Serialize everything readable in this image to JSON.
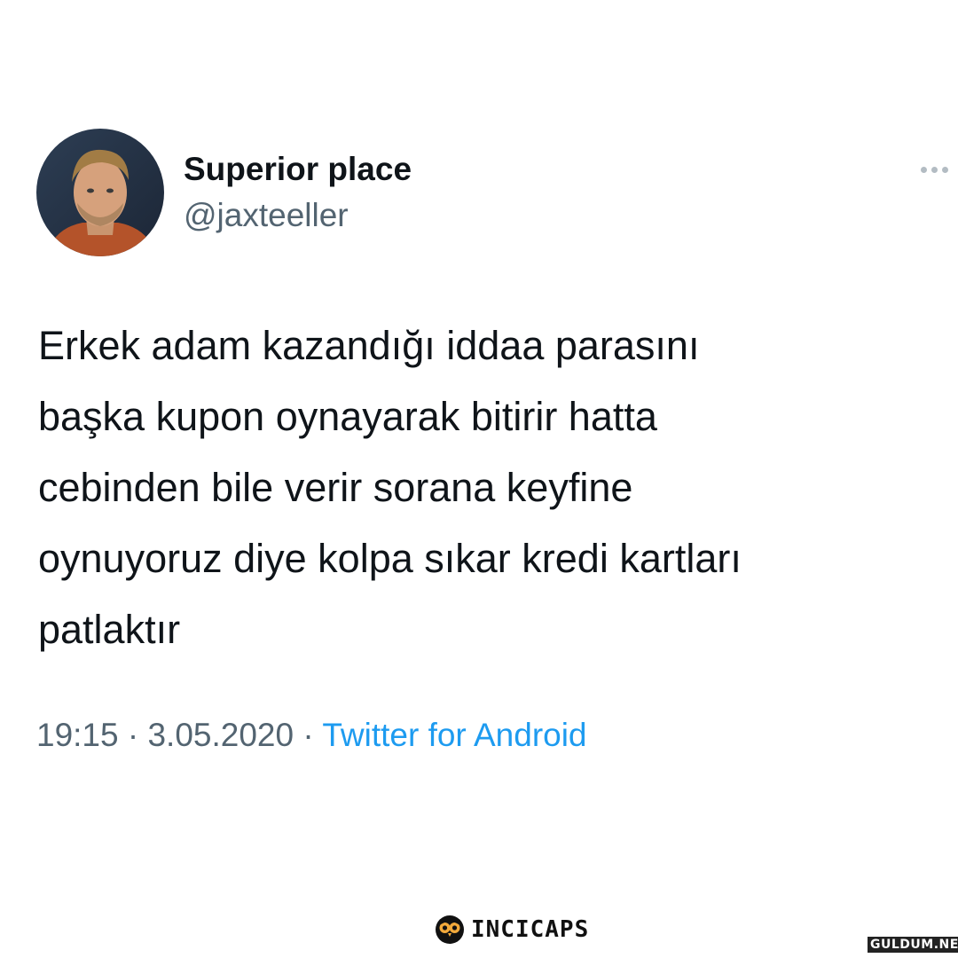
{
  "tweet": {
    "display_name": "Superior place",
    "handle": "@jaxteeller",
    "more_icon": "more-horizontal-icon",
    "text_lines": [
      "Erkek adam kazandığı iddaa parasını",
      "başka kupon oynayarak bitirir hatta",
      "cebinden bile verir sorana keyfine",
      "oynuyoruz diye kolpa sıkar kredi kartları",
      "patlaktır"
    ],
    "time": "19:15",
    "date": "3.05.2020",
    "separator": "·",
    "source": "Twitter for Android"
  },
  "branding": {
    "logo_icon": "owl-icon",
    "name": "INCICAPS",
    "watermark": "GULDUM.NET"
  },
  "colors": {
    "text_primary": "#0f1419",
    "text_secondary": "#536471",
    "link": "#1d9bf0",
    "background": "#ffffff"
  }
}
